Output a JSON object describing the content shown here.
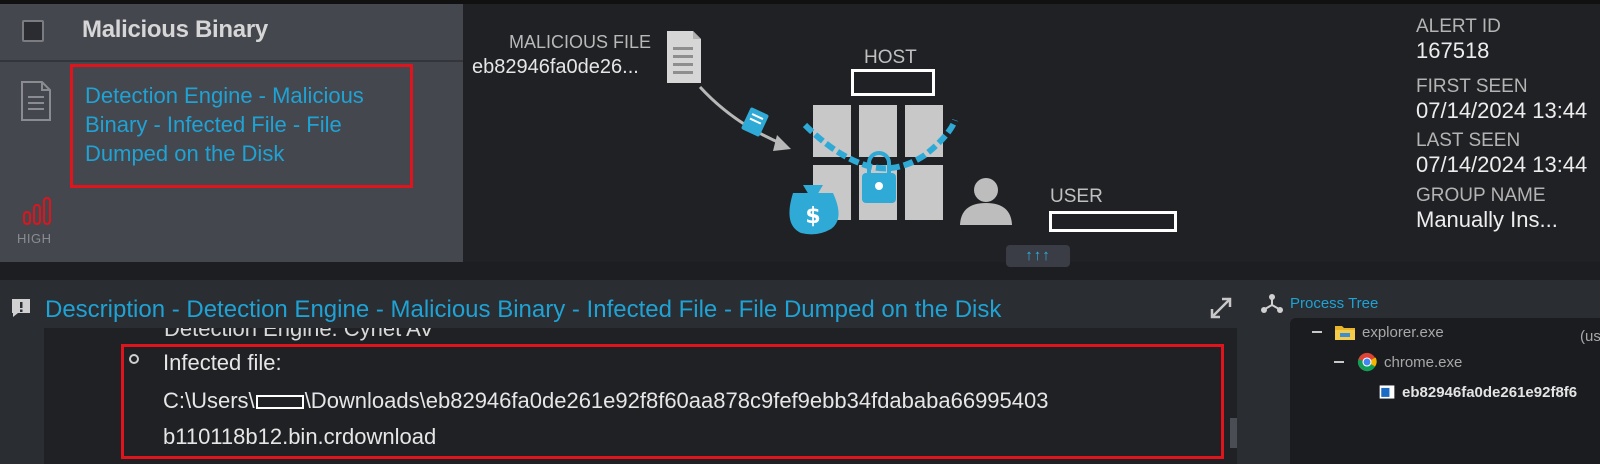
{
  "alert": {
    "title": "Malicious Binary",
    "name": "Detection Engine - Malicious Binary - Infected File - File Dumped on the Disk",
    "severity": "HIGH",
    "severity_color": "#e0141c"
  },
  "diagram": {
    "malicious_file_label": "MALICIOUS FILE",
    "malicious_file_hash": "eb82946fa0de26...",
    "host_label": "HOST",
    "user_label": "USER",
    "expand_label": "↑↑↑"
  },
  "meta": {
    "alert_id_label": "ALERT ID",
    "alert_id": "167518",
    "first_seen_label": "FIRST SEEN",
    "first_seen": "07/14/2024 13:44",
    "last_seen_label": "LAST SEEN",
    "last_seen": "07/14/2024 13:44",
    "group_name_label": "GROUP NAME",
    "group_name": "Manually Ins..."
  },
  "description": {
    "title": "Description - Detection Engine - Malicious Binary - Infected File - File Dumped on the Disk",
    "cut_line": "Detection Engine: Cynet AV",
    "infected_label": "Infected file:",
    "path_prefix": "C:\\Users\\",
    "path_suffix": "\\Downloads\\eb82946fa0de261e92f8f60aa878c9fef9ebb34fdababa66995403",
    "path_line2": "b110118b12.bin.crdownload"
  },
  "process_tree": {
    "title": "Process Tree",
    "nodes": [
      {
        "name": "explorer.exe",
        "icon": "folder-icon"
      },
      {
        "name": "chrome.exe",
        "icon": "chrome-icon"
      },
      {
        "name": "eb82946fa0de261e92f8f6",
        "icon": "binary-file-icon"
      }
    ],
    "user_hint": "(us"
  },
  "colors": {
    "accent": "#1fa2d4",
    "highlight_border": "#e0141c",
    "card_bg": "#45474f",
    "page_bg": "#1f2124"
  }
}
